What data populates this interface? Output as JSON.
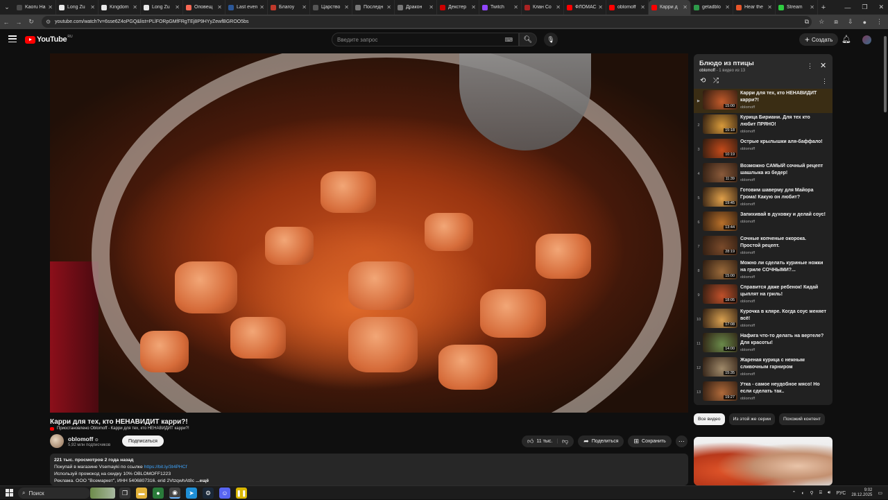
{
  "browser": {
    "tabs": [
      {
        "label": "Kaoru Ha",
        "color": "#4a4a4a"
      },
      {
        "label": "Long Zu",
        "color": "#e8e8e8"
      },
      {
        "label": "Kingdom",
        "color": "#e8e8e8"
      },
      {
        "label": "Long Zu",
        "color": "#e8e8e8"
      },
      {
        "label": "Оповещ",
        "color": "#f96854"
      },
      {
        "label": "Last even",
        "color": "#2b5797"
      },
      {
        "label": "Благоу",
        "color": "#c0392b"
      },
      {
        "label": "Царство",
        "color": "#555555"
      },
      {
        "label": "Последн",
        "color": "#777777"
      },
      {
        "label": "Дракон",
        "color": "#777777"
      },
      {
        "label": "Декстер",
        "color": "#cc0000"
      },
      {
        "label": "Twitch",
        "color": "#9146ff"
      },
      {
        "label": "Клан Со",
        "color": "#aa2222"
      },
      {
        "label": "ФЛОМАС",
        "color": "#ff0000"
      },
      {
        "label": "oblomoff",
        "color": "#ff0000"
      },
      {
        "label": "Карри д",
        "color": "#ff0000",
        "active": true
      },
      {
        "label": "getadblo",
        "color": "#2e9b4a"
      },
      {
        "label": "Hear the",
        "color": "#e8562a"
      },
      {
        "label": "Stream",
        "color": "#2ecc40"
      }
    ],
    "url": "youtube.com/watch?v=6sse6Z4oPGQ&list=PLlFORpGMfFRgTEj8P9HYyZewfBGROO5bs"
  },
  "header": {
    "logo_text": "YouTube",
    "logo_region": "RU",
    "search_placeholder": "Введите запрос",
    "create_label": "Создать"
  },
  "video": {
    "title": "Карри для тех, кто НЕНАВИДИТ карри?!",
    "paused_text": "Приостановлено Oblomoff - Карри для тех, кто НЕНАВИДИТ карри?!",
    "channel": "oblomoff",
    "subscribers": "5,92 млн подписчиков",
    "subscribe_label": "Подписаться",
    "likes": "11 тыс.",
    "share_label": "Поделиться",
    "save_label": "Сохранить",
    "description": {
      "stats": "221 тыс. просмотров  2 года назад",
      "line1_prefix": "Покупай в магазине Vsemayki по ссылке ",
      "line1_link": "https://bit.ly/3t4PHCf",
      "line2": "Используй промокод на скидку 10% OBLOMOFF1223",
      "line3": "Реклама. ООО \"Всемаркет\", ИНН 5406807316. erid 2VtzqwhAt8c",
      "more": "...ещё"
    }
  },
  "playlist": {
    "title": "Блюдо из птицы",
    "owner": "oblomoff",
    "position": "1 видео из 13",
    "items": [
      {
        "index": "▶",
        "title": "Карри для тех, кто НЕНАВИДИТ карри?!",
        "channel": "oblomoff",
        "duration": "15:00",
        "thumb": "#c25a2a",
        "current": true
      },
      {
        "index": "2",
        "title": "Курица Бириани. Для тех кто любит ПРЯНО!",
        "channel": "oblomoff",
        "duration": "15:18",
        "thumb": "#d89a3a"
      },
      {
        "index": "3",
        "title": "Острые крылышки аля-баффало!",
        "channel": "oblomoff",
        "duration": "10:19",
        "thumb": "#c44a1a"
      },
      {
        "index": "4",
        "title": "Возможно САМЫЙ сочный рецепт шашлыка из бедер!",
        "channel": "oblomoff",
        "duration": "11:39",
        "thumb": "#8a5a3a"
      },
      {
        "index": "5",
        "title": "Готовим шаверму для Майора Грома! Какую он любит?",
        "channel": "oblomoff",
        "duration": "19:45",
        "thumb": "#e0a04a"
      },
      {
        "index": "6",
        "title": "Запихивай в духовку и делай соус!",
        "channel": "oblomoff",
        "duration": "13:44",
        "thumb": "#b8702a"
      },
      {
        "index": "7",
        "title": "Сочные копченые окорока. Простой рецепт.",
        "channel": "oblomoff",
        "duration": "28:19",
        "thumb": "#7a4a2a"
      },
      {
        "index": "8",
        "title": "Можно ли сделать куриные ножки на гриле СОЧНЫМИ?...",
        "channel": "oblomoff",
        "duration": "15:00",
        "thumb": "#9a6a3a"
      },
      {
        "index": "9",
        "title": "Справится даже ребенок! Кидай цыплят на гриль!",
        "channel": "oblomoff",
        "duration": "18:05",
        "thumb": "#c0502a"
      },
      {
        "index": "10",
        "title": "Курочка в кляре. Когда соус меняет всё!",
        "channel": "oblomoff",
        "duration": "17:08",
        "thumb": "#d8a050"
      },
      {
        "index": "11",
        "title": "Нафига что-то делать на вертеле? Для красоты!",
        "channel": "oblomoff",
        "duration": "14:00",
        "thumb": "#6a8a4a"
      },
      {
        "index": "12",
        "title": "Жареная курица с нежным сливочным гарниром",
        "channel": "oblomoff",
        "duration": "15:35",
        "thumb": "#a08a6a"
      },
      {
        "index": "13",
        "title": "Утка - самое неудобное мясо! Но если сделать так..",
        "channel": "oblomoff",
        "duration": "19:27",
        "thumb": "#b06a3a"
      }
    ]
  },
  "chips": [
    "Все видео",
    "Из этой же серии",
    "Похожий контент"
  ],
  "taskbar": {
    "search_label": "Поиск",
    "lang": "РУС",
    "time": "9:02",
    "date": "28.12.2025"
  }
}
